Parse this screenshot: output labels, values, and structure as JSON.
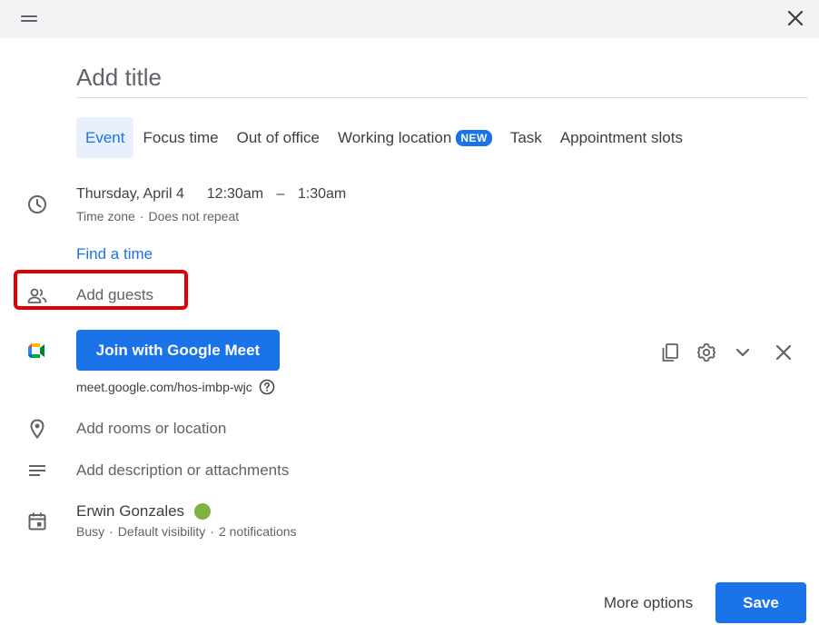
{
  "header": {
    "drag_icon": "drag-handle-icon",
    "close_icon": "close-icon"
  },
  "title": {
    "placeholder": "Add title"
  },
  "tabs": [
    {
      "label": "Event",
      "active": true
    },
    {
      "label": "Focus time"
    },
    {
      "label": "Out of office"
    },
    {
      "label": "Working location",
      "badge": "NEW"
    },
    {
      "label": "Task"
    },
    {
      "label": "Appointment slots"
    }
  ],
  "schedule": {
    "date": "Thursday, April 4",
    "start_time": "12:30am",
    "separator": "–",
    "end_time": "1:30am",
    "timezone": "Time zone",
    "dot": "·",
    "repeat": "Does not repeat",
    "find_time": "Find a time"
  },
  "guests": {
    "placeholder": "Add guests"
  },
  "meet": {
    "button_label": "Join with Google Meet",
    "link": "meet.google.com/hos-imbp-wjc"
  },
  "location": {
    "placeholder": "Add rooms or location"
  },
  "description": {
    "placeholder": "Add description or attachments"
  },
  "owner": {
    "name": "Erwin Gonzales",
    "status_color": "#7cb342",
    "busy": "Busy",
    "visibility": "Default visibility",
    "notifications": "2 notifications",
    "dot": "·"
  },
  "footer": {
    "more_options": "More options",
    "save": "Save"
  },
  "colors": {
    "accent": "#1a73e8",
    "highlight": "#e00000",
    "topbar": "#f1f3f4"
  }
}
